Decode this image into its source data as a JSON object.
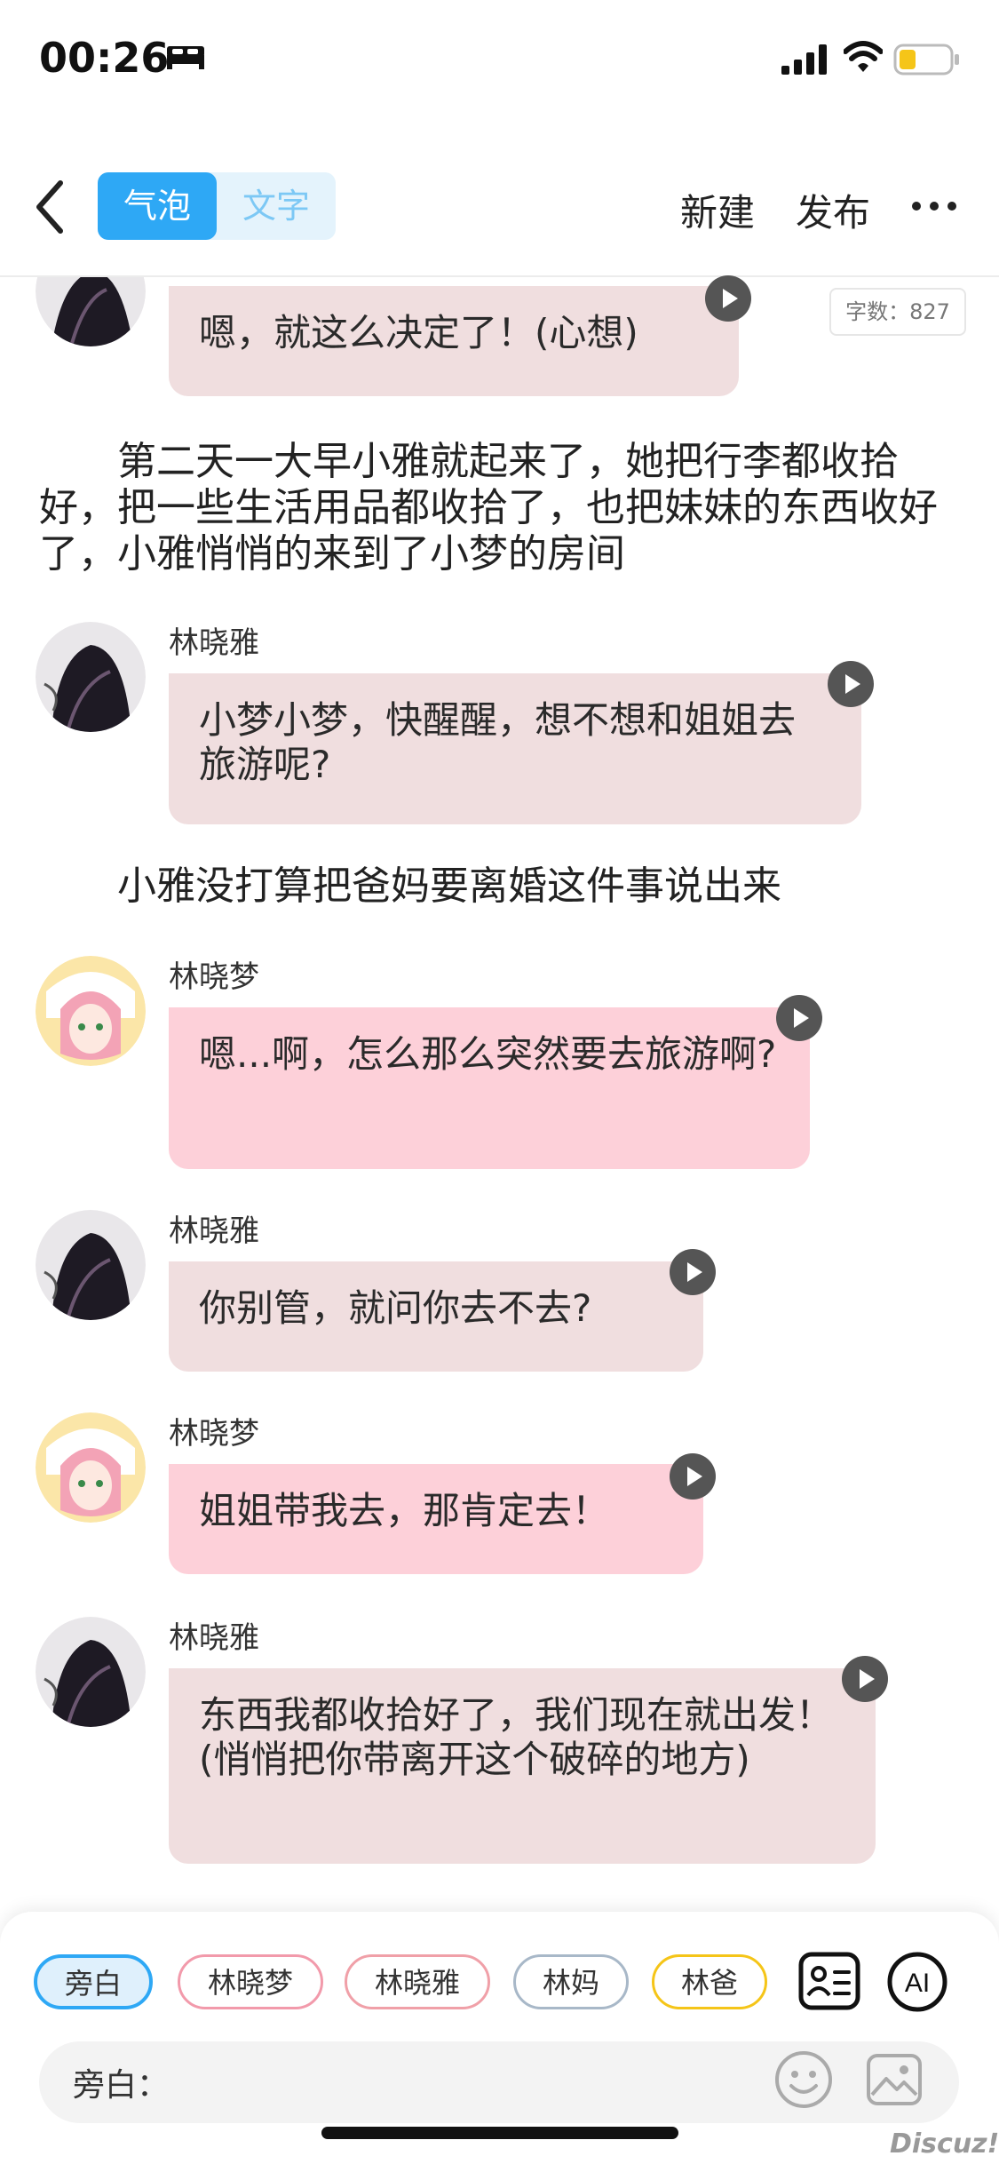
{
  "status": {
    "time": "00:26"
  },
  "nav": {
    "mode_bubble": "气泡",
    "mode_text": "文字",
    "new": "新建",
    "publish": "发布"
  },
  "word_count": "字数：827",
  "messages": [
    {
      "text": "嗯，就这么决定了！(心想)"
    },
    {
      "narration": "　　第二天一大早小雅就起来了，她把行李都收拾好，把一些生活用品都收拾了，也把妹妹的东西收好了，小雅悄悄的来到了小梦的房间"
    },
    {
      "name": "林晓雅",
      "text": "小梦小梦，快醒醒，想不想和姐姐去旅游呢?"
    },
    {
      "narration": "　　小雅没打算把爸妈要离婚这件事说出来"
    },
    {
      "name": "林晓梦",
      "text": "嗯...啊，怎么那么突然要去旅游啊?"
    },
    {
      "name": "林晓雅",
      "text": "你别管，就问你去不去?"
    },
    {
      "name": "林晓梦",
      "text": "姐姐带我去，那肯定去！"
    },
    {
      "name": "林晓雅",
      "text": "东西我都收拾好了，我们现在就出发！(悄悄把你带离开这个破碎的地方)"
    }
  ],
  "bottom": {
    "chips": [
      "旁白",
      "林晓梦",
      "林晓雅",
      "林妈",
      "林爸"
    ],
    "ai_label": "AI",
    "input_label": "旁白："
  },
  "watermark": "Discuz!",
  "colors": {
    "accent": "#2ea8f5",
    "bubble_ya": "#f0dedf",
    "bubble_meng": "#fdd0d9"
  },
  "icons": [
    "bed-icon",
    "signal-icon",
    "wifi-icon",
    "battery-icon",
    "back-icon",
    "more-icon",
    "play-icon",
    "card-icon",
    "ai-icon",
    "emoji-icon",
    "image-icon"
  ]
}
